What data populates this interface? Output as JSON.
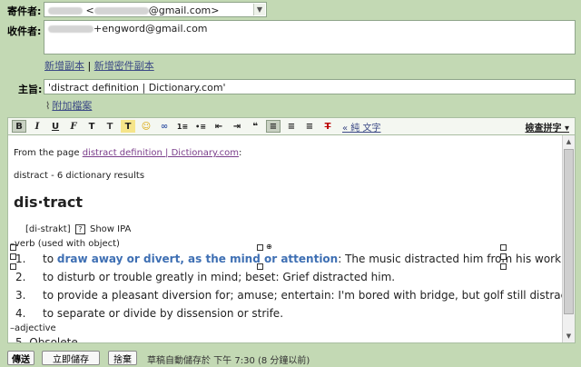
{
  "from": {
    "label": "寄件者:",
    "email_suffix": "@gmail.com>",
    "email_prefix": "<"
  },
  "to": {
    "label": "收件者:",
    "value_suffix": "+engword@gmail.com"
  },
  "cc_links": {
    "add_cc": "新增副本",
    "separator": "|",
    "add_bcc": "新增密件副本"
  },
  "subject": {
    "label": "主旨:",
    "value": "'distract definition | Dictionary.com'"
  },
  "attach": {
    "label": "附加檔案"
  },
  "toolbar": {
    "items": [
      "B",
      "I",
      "U",
      "F",
      "T",
      "T",
      "T",
      "☺",
      "∞",
      "1≡",
      "•≡",
      "⇤",
      "⇥",
      "❝",
      "≡",
      "≡",
      "≡",
      "T"
    ],
    "plain_text": "« 純 文字",
    "spellcheck": "檢查拼字 ▾"
  },
  "body": {
    "from_page_prefix": "From the page ",
    "from_page_link": "distract definition | Dictionary.com",
    "from_page_suffix": ":",
    "results": "distract - 6 dictionary results",
    "headword": "dis·tract",
    "pron": "[di-strakt]",
    "ipa": "Show IPA",
    "pos_verb": "–verb (used with object)",
    "defs": [
      {
        "n": "1.",
        "pre": "to ",
        "em": "draw away or divert, as the mind or attention",
        "post": ": The music distracted him from his work."
      },
      {
        "n": "2.",
        "pre": "to disturb or trouble greatly in mind; beset: Grief distracted him.",
        "em": "",
        "post": ""
      },
      {
        "n": "3.",
        "pre": "to provide a pleasant diversion for; amuse; entertain: I'm bored with bridge, but golf still distracts me.",
        "em": "",
        "post": ""
      },
      {
        "n": "4.",
        "pre": "to separate or divide by dissension or strife.",
        "em": "",
        "post": ""
      }
    ],
    "pos_adj": "–adjective",
    "partial_next": "5.   Obsolete."
  },
  "bottom": {
    "send": "傳送",
    "save": "立即儲存",
    "discard": "捨棄",
    "status": "草稿自動儲存於 下午 7:30 (8 分鐘以前)"
  }
}
